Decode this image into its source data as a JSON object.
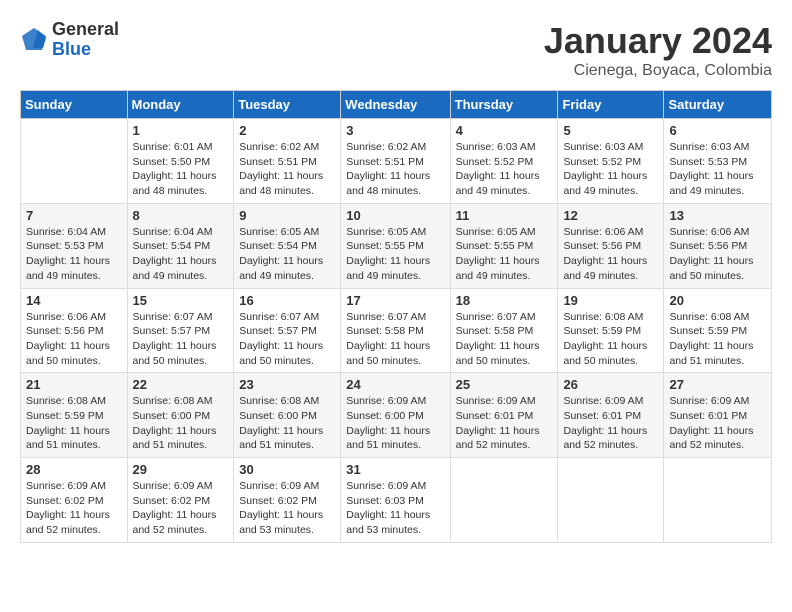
{
  "header": {
    "logo_general": "General",
    "logo_blue": "Blue",
    "title": "January 2024",
    "subtitle": "Cienega, Boyaca, Colombia"
  },
  "weekdays": [
    "Sunday",
    "Monday",
    "Tuesday",
    "Wednesday",
    "Thursday",
    "Friday",
    "Saturday"
  ],
  "weeks": [
    [
      {
        "day": "",
        "info": ""
      },
      {
        "day": "1",
        "info": "Sunrise: 6:01 AM\nSunset: 5:50 PM\nDaylight: 11 hours\nand 48 minutes."
      },
      {
        "day": "2",
        "info": "Sunrise: 6:02 AM\nSunset: 5:51 PM\nDaylight: 11 hours\nand 48 minutes."
      },
      {
        "day": "3",
        "info": "Sunrise: 6:02 AM\nSunset: 5:51 PM\nDaylight: 11 hours\nand 48 minutes."
      },
      {
        "day": "4",
        "info": "Sunrise: 6:03 AM\nSunset: 5:52 PM\nDaylight: 11 hours\nand 49 minutes."
      },
      {
        "day": "5",
        "info": "Sunrise: 6:03 AM\nSunset: 5:52 PM\nDaylight: 11 hours\nand 49 minutes."
      },
      {
        "day": "6",
        "info": "Sunrise: 6:03 AM\nSunset: 5:53 PM\nDaylight: 11 hours\nand 49 minutes."
      }
    ],
    [
      {
        "day": "7",
        "info": "Sunrise: 6:04 AM\nSunset: 5:53 PM\nDaylight: 11 hours\nand 49 minutes."
      },
      {
        "day": "8",
        "info": "Sunrise: 6:04 AM\nSunset: 5:54 PM\nDaylight: 11 hours\nand 49 minutes."
      },
      {
        "day": "9",
        "info": "Sunrise: 6:05 AM\nSunset: 5:54 PM\nDaylight: 11 hours\nand 49 minutes."
      },
      {
        "day": "10",
        "info": "Sunrise: 6:05 AM\nSunset: 5:55 PM\nDaylight: 11 hours\nand 49 minutes."
      },
      {
        "day": "11",
        "info": "Sunrise: 6:05 AM\nSunset: 5:55 PM\nDaylight: 11 hours\nand 49 minutes."
      },
      {
        "day": "12",
        "info": "Sunrise: 6:06 AM\nSunset: 5:56 PM\nDaylight: 11 hours\nand 49 minutes."
      },
      {
        "day": "13",
        "info": "Sunrise: 6:06 AM\nSunset: 5:56 PM\nDaylight: 11 hours\nand 50 minutes."
      }
    ],
    [
      {
        "day": "14",
        "info": "Sunrise: 6:06 AM\nSunset: 5:56 PM\nDaylight: 11 hours\nand 50 minutes."
      },
      {
        "day": "15",
        "info": "Sunrise: 6:07 AM\nSunset: 5:57 PM\nDaylight: 11 hours\nand 50 minutes."
      },
      {
        "day": "16",
        "info": "Sunrise: 6:07 AM\nSunset: 5:57 PM\nDaylight: 11 hours\nand 50 minutes."
      },
      {
        "day": "17",
        "info": "Sunrise: 6:07 AM\nSunset: 5:58 PM\nDaylight: 11 hours\nand 50 minutes."
      },
      {
        "day": "18",
        "info": "Sunrise: 6:07 AM\nSunset: 5:58 PM\nDaylight: 11 hours\nand 50 minutes."
      },
      {
        "day": "19",
        "info": "Sunrise: 6:08 AM\nSunset: 5:59 PM\nDaylight: 11 hours\nand 50 minutes."
      },
      {
        "day": "20",
        "info": "Sunrise: 6:08 AM\nSunset: 5:59 PM\nDaylight: 11 hours\nand 51 minutes."
      }
    ],
    [
      {
        "day": "21",
        "info": "Sunrise: 6:08 AM\nSunset: 5:59 PM\nDaylight: 11 hours\nand 51 minutes."
      },
      {
        "day": "22",
        "info": "Sunrise: 6:08 AM\nSunset: 6:00 PM\nDaylight: 11 hours\nand 51 minutes."
      },
      {
        "day": "23",
        "info": "Sunrise: 6:08 AM\nSunset: 6:00 PM\nDaylight: 11 hours\nand 51 minutes."
      },
      {
        "day": "24",
        "info": "Sunrise: 6:09 AM\nSunset: 6:00 PM\nDaylight: 11 hours\nand 51 minutes."
      },
      {
        "day": "25",
        "info": "Sunrise: 6:09 AM\nSunset: 6:01 PM\nDaylight: 11 hours\nand 52 minutes."
      },
      {
        "day": "26",
        "info": "Sunrise: 6:09 AM\nSunset: 6:01 PM\nDaylight: 11 hours\nand 52 minutes."
      },
      {
        "day": "27",
        "info": "Sunrise: 6:09 AM\nSunset: 6:01 PM\nDaylight: 11 hours\nand 52 minutes."
      }
    ],
    [
      {
        "day": "28",
        "info": "Sunrise: 6:09 AM\nSunset: 6:02 PM\nDaylight: 11 hours\nand 52 minutes."
      },
      {
        "day": "29",
        "info": "Sunrise: 6:09 AM\nSunset: 6:02 PM\nDaylight: 11 hours\nand 52 minutes."
      },
      {
        "day": "30",
        "info": "Sunrise: 6:09 AM\nSunset: 6:02 PM\nDaylight: 11 hours\nand 53 minutes."
      },
      {
        "day": "31",
        "info": "Sunrise: 6:09 AM\nSunset: 6:03 PM\nDaylight: 11 hours\nand 53 minutes."
      },
      {
        "day": "",
        "info": ""
      },
      {
        "day": "",
        "info": ""
      },
      {
        "day": "",
        "info": ""
      }
    ]
  ]
}
